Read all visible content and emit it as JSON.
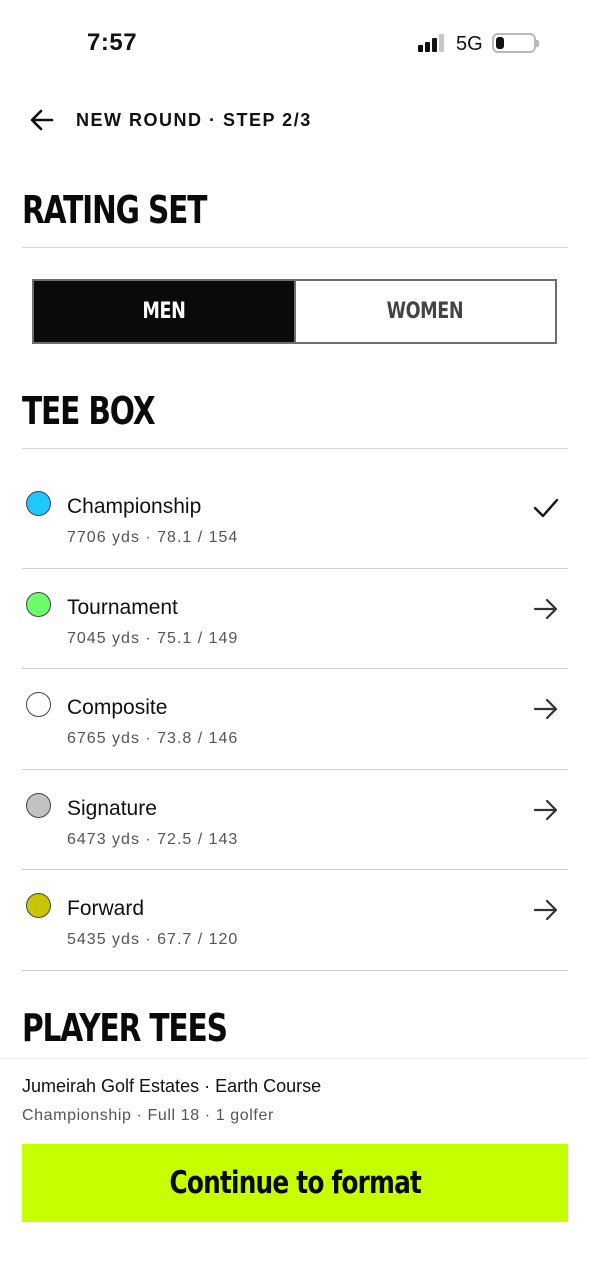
{
  "status_bar": {
    "time": "7:57",
    "network": "5G",
    "battery": "21"
  },
  "nav": {
    "title": "NEW ROUND · STEP 2/3",
    "back_icon": "arrow-left-icon"
  },
  "rating_set": {
    "title": "RATING SET",
    "options": [
      {
        "label": "MEN",
        "selected": true
      },
      {
        "label": "WOMEN",
        "selected": false
      }
    ]
  },
  "tee_box": {
    "title": "TEE BOX",
    "tees": [
      {
        "name": "Championship",
        "meta": "7706 yds · 78.1 / 154",
        "color": "#1ec8ff",
        "action_icon": "check-icon",
        "selected": true
      },
      {
        "name": "Tournament",
        "meta": "7045 yds · 75.1 / 149",
        "color": "#6cff6c",
        "action_icon": "arrow-right-icon",
        "selected": false
      },
      {
        "name": "Composite",
        "meta": "6765 yds · 73.8 / 146",
        "color": "#ffffff",
        "action_icon": "arrow-right-icon",
        "selected": false
      },
      {
        "name": "Signature",
        "meta": "6473 yds · 72.5 / 143",
        "color": "#c2c2c2",
        "action_icon": "arrow-right-icon",
        "selected": false
      },
      {
        "name": "Forward",
        "meta": "5435 yds · 67.7 / 120",
        "color": "#c9c600",
        "action_icon": "arrow-right-icon",
        "selected": false
      }
    ]
  },
  "player_tees": {
    "title": "PLAYER TEES"
  },
  "summary": {
    "course": "Jumeirah Golf Estates · Earth Course",
    "detail": "Championship · Full 18 · 1 golfer"
  },
  "cta": {
    "label": "Continue to format",
    "color": "#c6ff00"
  }
}
